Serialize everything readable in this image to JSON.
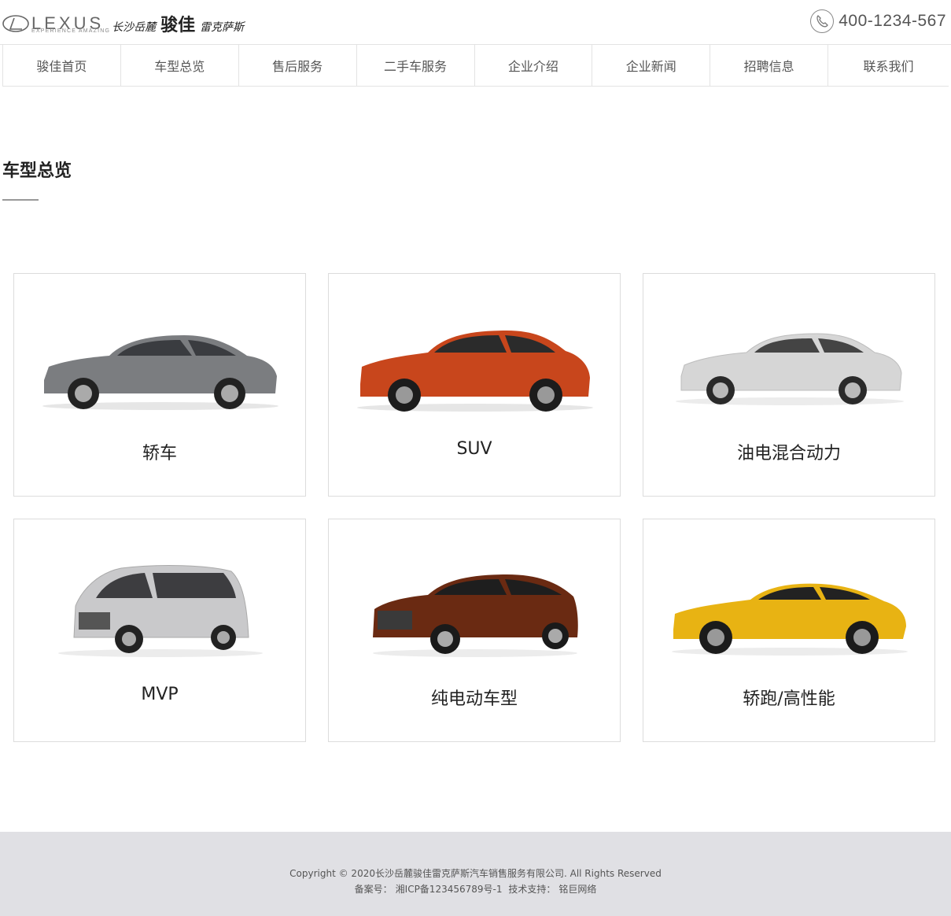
{
  "header": {
    "brand_word": "LEXUS",
    "brand_tagline": "EXPERIENCE AMAZING",
    "dealer_city": "长沙岳麓",
    "dealer_name": "骏佳",
    "dealer_brand": "雷克萨斯",
    "phone": "400-1234-567"
  },
  "nav": {
    "items": [
      {
        "label": "骏佳首页"
      },
      {
        "label": "车型总览"
      },
      {
        "label": "售后服务"
      },
      {
        "label": "二手车服务"
      },
      {
        "label": "企业介绍"
      },
      {
        "label": "企业新闻"
      },
      {
        "label": "招聘信息"
      },
      {
        "label": "联系我们"
      }
    ]
  },
  "section": {
    "title": "车型总览"
  },
  "cards": [
    {
      "label": "轿车",
      "car_icon": "sedan-car-icon",
      "color": "#7b7d80"
    },
    {
      "label": "SUV",
      "car_icon": "suv-car-icon",
      "color": "#c8461c"
    },
    {
      "label": "油电混合动力",
      "car_icon": "hybrid-car-icon",
      "color": "#d6d6d6"
    },
    {
      "label": "MVP",
      "car_icon": "mvp-van-icon",
      "color": "#c9c9cb"
    },
    {
      "label": "纯电动车型",
      "car_icon": "electric-car-icon",
      "color": "#6a2a12"
    },
    {
      "label": "轿跑/高性能",
      "car_icon": "coupe-car-icon",
      "color": "#e8b313"
    }
  ],
  "footer": {
    "copyright": "Copyright © 2020长沙岳麓骏佳雷克萨斯汽车销售服务有限公司. All Rights Reserved",
    "icp_label": "备案号：",
    "icp_number": "湘ICP备123456789号-1",
    "tech_label": "技术支持：",
    "tech_vendor": "铭巨网络"
  }
}
